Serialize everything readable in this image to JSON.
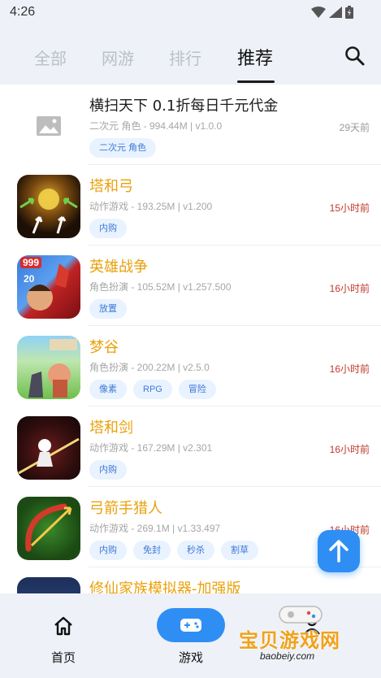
{
  "status": {
    "time": "4:26"
  },
  "tabs": [
    {
      "label": "全部"
    },
    {
      "label": "网游"
    },
    {
      "label": "排行"
    },
    {
      "label": "推荐"
    }
  ],
  "items": [
    {
      "title": "横扫天下 0.1折每日千元代金",
      "meta": "二次元 角色 - 994.44M | v1.0.0",
      "time": "29天前",
      "tags": [
        "二次元 角色"
      ]
    },
    {
      "title": "塔和弓",
      "meta": "动作游戏 - 193.25M | v1.200",
      "time": "15小时前",
      "tags": [
        "内购"
      ]
    },
    {
      "title": "英雄战争",
      "meta": "角色扮演 - 105.52M | v1.257.500",
      "time": "16小时前",
      "tags": [
        "放置"
      ],
      "badges": [
        "999",
        "20"
      ]
    },
    {
      "title": "梦谷",
      "meta": "角色扮演 - 200.22M | v2.5.0",
      "time": "16小时前",
      "tags": [
        "像素",
        "RPG",
        "冒险"
      ]
    },
    {
      "title": "塔和剑",
      "meta": "动作游戏 - 167.29M | v2.301",
      "time": "16小时前",
      "tags": [
        "内购"
      ]
    },
    {
      "title": "弓箭手猎人",
      "meta": "动作游戏 - 269.1M | v1.33.497",
      "time": "16小时前",
      "tags": [
        "内购",
        "免封",
        "秒杀",
        "割草"
      ]
    },
    {
      "title": "修仙家族模拟器-加强版"
    }
  ],
  "nav": {
    "home": "首页",
    "game": "游戏"
  },
  "watermark": {
    "text": "宝贝游戏网",
    "url": "baobeiy.com"
  },
  "colors": {
    "accent": "#2f8ef4",
    "title_orange": "#eaa10a",
    "time_red": "#c0392b"
  }
}
